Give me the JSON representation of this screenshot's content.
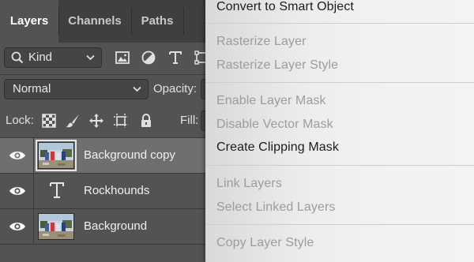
{
  "panel": {
    "tabs": [
      {
        "label": "Layers",
        "active": true
      },
      {
        "label": "Channels",
        "active": false
      },
      {
        "label": "Paths",
        "active": false
      }
    ],
    "filter": {
      "kind_label": "Kind"
    },
    "blend_mode": "Normal",
    "opacity_label": "Opacity:",
    "lock_label": "Lock:",
    "fill_label": "Fill:",
    "layers": [
      {
        "name": "Background copy",
        "type": "pixel",
        "visible": true,
        "selected": true
      },
      {
        "name": "Rockhounds",
        "type": "text",
        "visible": true,
        "selected": false
      },
      {
        "name": "Background",
        "type": "pixel",
        "visible": true,
        "selected": false
      }
    ]
  },
  "context_menu": {
    "items": [
      {
        "label": "Convert to Smart Object",
        "enabled": true
      },
      {
        "label": "Rasterize Layer",
        "enabled": false
      },
      {
        "label": "Rasterize Layer Style",
        "enabled": false
      },
      {
        "label": "Enable Layer Mask",
        "enabled": false
      },
      {
        "label": "Disable Vector Mask",
        "enabled": false
      },
      {
        "label": "Create Clipping Mask",
        "enabled": true
      },
      {
        "label": "Link Layers",
        "enabled": false
      },
      {
        "label": "Select Linked Layers",
        "enabled": false
      },
      {
        "label": "Copy Layer Style",
        "enabled": false
      }
    ]
  }
}
